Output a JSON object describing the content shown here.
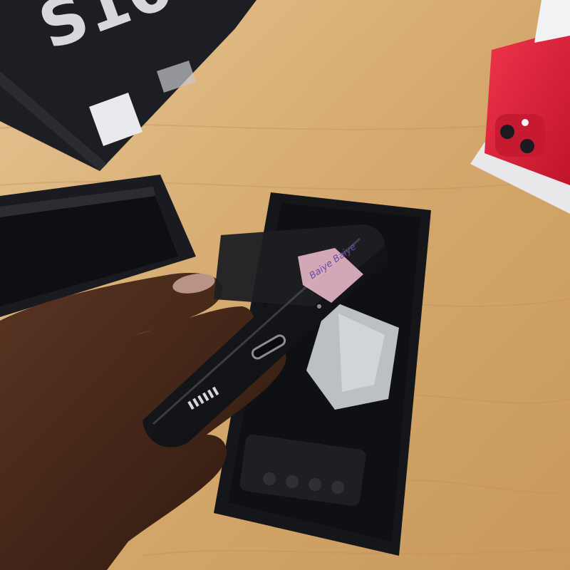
{
  "photo": {
    "box_text": "S10",
    "sticker_text": "Baiye Baiye",
    "colors": {
      "table": "#d2a86f",
      "table_light": "#e2bf8a",
      "box_black": "#1c1d22",
      "tray_black": "#141519",
      "red_phone": "#e0213a",
      "skin": "#4a2a1a",
      "sticker": "#e7b8c8"
    }
  }
}
